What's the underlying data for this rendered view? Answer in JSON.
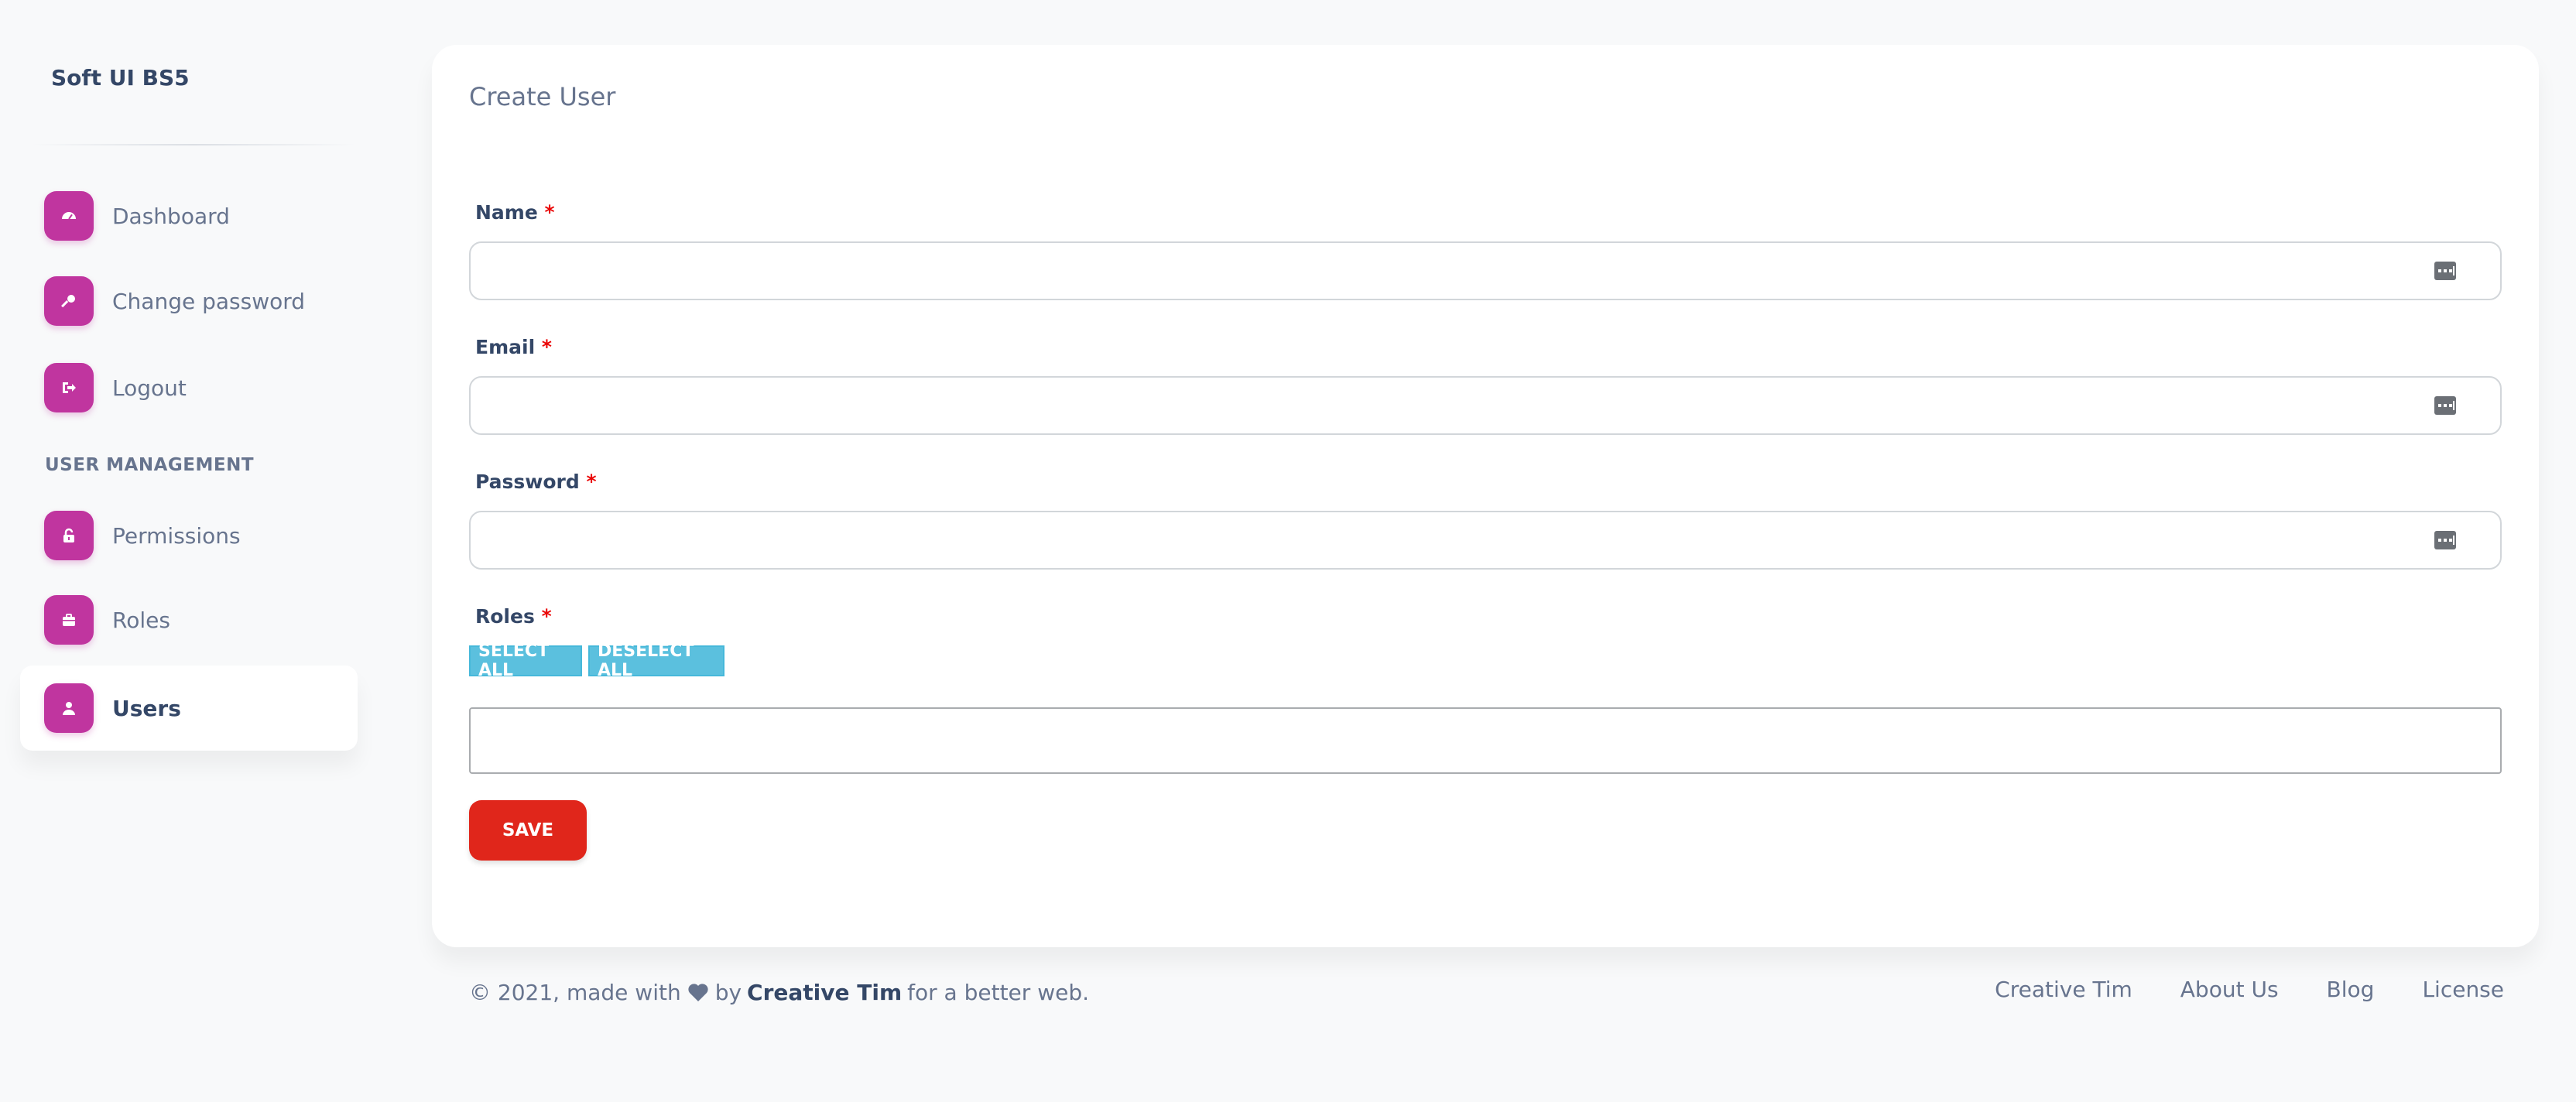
{
  "sidebar": {
    "brand": "Soft UI BS5",
    "items": [
      {
        "label": "Dashboard",
        "icon": "dashboard-icon"
      },
      {
        "label": "Change password",
        "icon": "key-icon"
      },
      {
        "label": "Logout",
        "icon": "logout-icon"
      }
    ],
    "section_heading": "USER MANAGEMENT",
    "management_items": [
      {
        "label": "Permissions",
        "icon": "lock-open-icon"
      },
      {
        "label": "Roles",
        "icon": "briefcase-icon"
      },
      {
        "label": "Users",
        "icon": "user-icon",
        "active": true
      }
    ]
  },
  "form": {
    "title": "Create User",
    "name_label": "Name",
    "email_label": "Email",
    "password_label": "Password",
    "roles_label": "Roles",
    "required_mark": "*",
    "name_value": "",
    "email_value": "",
    "password_value": "",
    "select_all_label": "SELECT ALL",
    "deselect_all_label": "DESELECT ALL",
    "save_label": "SAVE"
  },
  "footer": {
    "prefix": "© 2021, made with",
    "by": "by",
    "author": "Creative Tim",
    "suffix": "for a better web.",
    "links": [
      "Creative Tim",
      "About Us",
      "Blog",
      "License"
    ]
  },
  "colors": {
    "accent": "#c0359f",
    "save": "#e0261b",
    "info": "#5bc0de",
    "required": "#ea0606"
  }
}
